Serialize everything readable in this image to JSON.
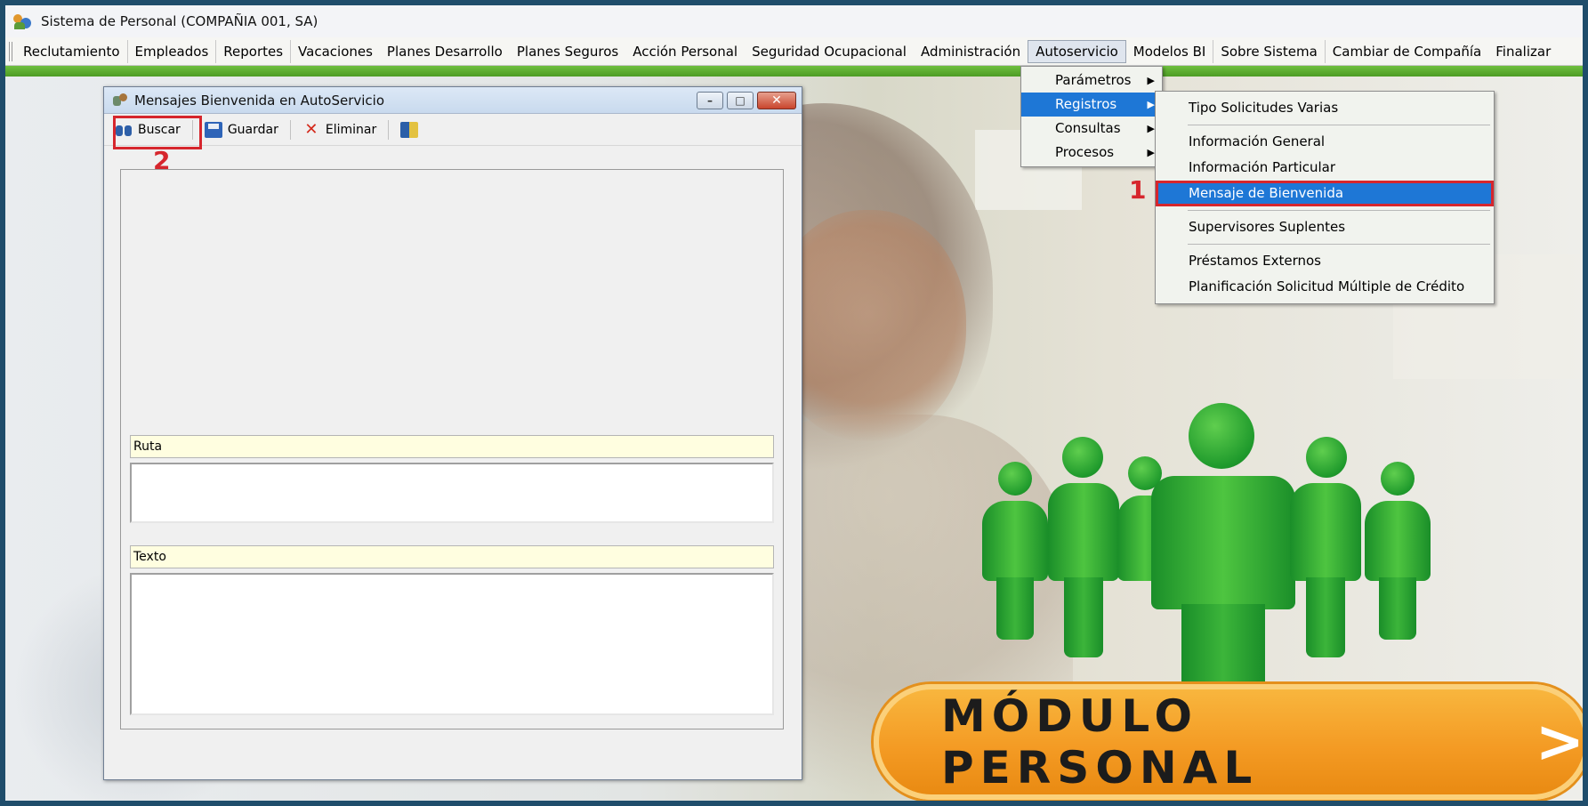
{
  "app": {
    "title": "Sistema de Personal (COMPAÑIA 001, SA)"
  },
  "menubar": {
    "items": [
      {
        "label": "Reclutamiento"
      },
      {
        "label": "Empleados"
      },
      {
        "label": "Reportes"
      },
      {
        "label": "Vacaciones"
      },
      {
        "label": "Planes Desarrollo"
      },
      {
        "label": "Planes Seguros"
      },
      {
        "label": "Acción Personal"
      },
      {
        "label": "Seguridad Ocupacional"
      },
      {
        "label": "Administración"
      },
      {
        "label": "Autoservicio"
      },
      {
        "label": "Modelos BI"
      },
      {
        "label": "Sobre Sistema"
      },
      {
        "label": "Cambiar de Compañía"
      },
      {
        "label": "Finalizar"
      }
    ],
    "active": "Autoservicio"
  },
  "autoservicio_menu": {
    "items": [
      {
        "label": "Parámetros"
      },
      {
        "label": "Registros"
      },
      {
        "label": "Consultas"
      },
      {
        "label": "Procesos"
      }
    ]
  },
  "registros_submenu": {
    "items": [
      {
        "label": "Tipo Solicitudes Varias"
      },
      {
        "label": "Información General"
      },
      {
        "label": "Información Particular"
      },
      {
        "label": "Mensaje de Bienvenida"
      },
      {
        "label": "Supervisores Suplentes"
      },
      {
        "label": "Préstamos Externos"
      },
      {
        "label": "Planificación Solicitud Múltiple de Crédito"
      }
    ],
    "selected": "Mensaje de Bienvenida"
  },
  "annotations": {
    "step1": "1",
    "step2": "2"
  },
  "window": {
    "title": "Mensajes Bienvenida en AutoServicio",
    "toolbar": {
      "buscar": "Buscar",
      "guardar": "Guardar",
      "eliminar": "Eliminar"
    },
    "fields": {
      "ruta_label": "Ruta",
      "ruta_value": "",
      "texto_label": "Texto",
      "texto_value": ""
    }
  },
  "banner": {
    "text": "MÓDULO PERSONAL",
    "chevron": ">"
  },
  "colors": {
    "menu_highlight": "#1e77d6",
    "annotation_red": "#d6262d",
    "green_strip": "#4d9c24",
    "banner_orange": "#f49b24"
  }
}
